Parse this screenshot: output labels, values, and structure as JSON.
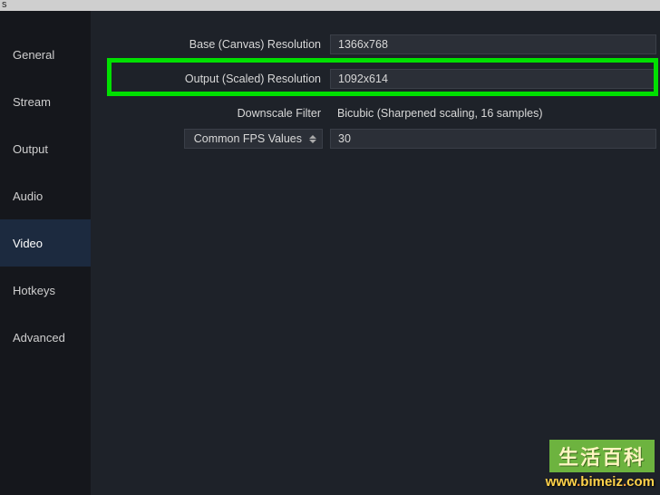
{
  "titlebar": {
    "text": "s"
  },
  "sidebar": {
    "items": [
      {
        "label": "General"
      },
      {
        "label": "Stream"
      },
      {
        "label": "Output"
      },
      {
        "label": "Audio"
      },
      {
        "label": "Video"
      },
      {
        "label": "Hotkeys"
      },
      {
        "label": "Advanced"
      }
    ],
    "activeIndex": 4
  },
  "video": {
    "base": {
      "label": "Base (Canvas) Resolution",
      "value": "1366x768"
    },
    "output": {
      "label": "Output (Scaled) Resolution",
      "value": "1092x614"
    },
    "downscale": {
      "label": "Downscale Filter",
      "value": "Bicubic (Sharpened scaling, 16 samples)"
    },
    "fps": {
      "selector_label": "Common FPS Values",
      "value": "30"
    }
  },
  "watermark": {
    "top": "生活百科",
    "url_prefix": "www",
    "url_domain": "bimeiz",
    "url_suffix": "com"
  }
}
